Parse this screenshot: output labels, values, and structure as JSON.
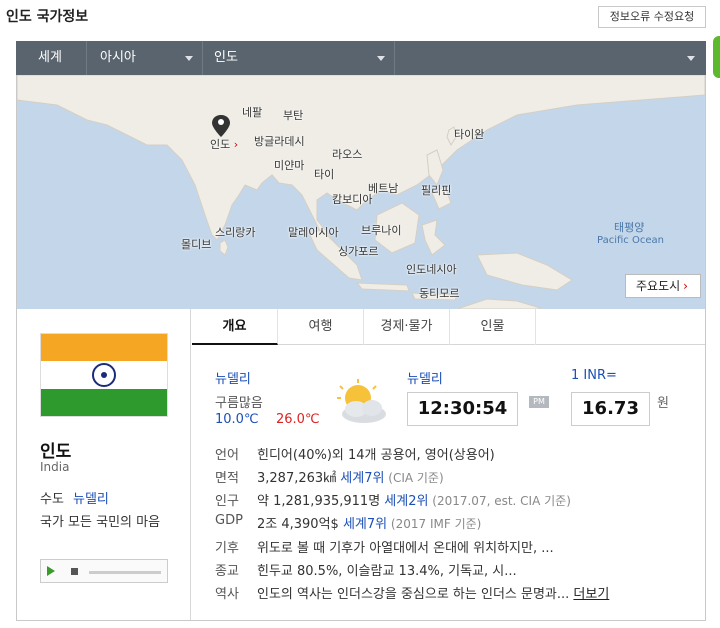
{
  "header": {
    "title": "인도 국가정보",
    "report_button": "정보오류 수정요청"
  },
  "nav": {
    "items": [
      {
        "label": "세계"
      },
      {
        "label": "아시아"
      },
      {
        "label": "인도"
      }
    ]
  },
  "map": {
    "labels": {
      "nepal": "네팔",
      "bhutan": "부탄",
      "india": "인도",
      "bangladesh": "방글라데시",
      "myanmar": "미얀마",
      "laos": "라오스",
      "taiwan": "타이완",
      "thailand": "타이",
      "vietnam": "베트남",
      "philippines": "필리핀",
      "cambodia": "캄보디아",
      "srilanka": "스리랑카",
      "maldives": "몰디브",
      "malaysia": "말레이시아",
      "brunei": "브루나이",
      "singapore": "싱가포르",
      "indonesia": "인도네시아",
      "easttimor": "동티모르",
      "pacific_ko": "태평양",
      "pacific_en": "Pacific Ocean"
    },
    "india_arrow": "›",
    "cities_button": "주요도시",
    "cities_arrow": "›"
  },
  "country": {
    "name_ko": "인도",
    "name_en": "India",
    "capital_label": "수도",
    "capital": "뉴델리",
    "anthem_text": "국가 모든 국민의 마음"
  },
  "flag": {
    "colors": [
      "#f5a623",
      "#ffffff",
      "#2e9a2e"
    ],
    "chakra_color": "#1b2b7a"
  },
  "tabs": [
    {
      "label": "개요",
      "active": true
    },
    {
      "label": "여행",
      "active": false
    },
    {
      "label": "경제·물가",
      "active": false
    },
    {
      "label": "인물",
      "active": false
    }
  ],
  "weather": {
    "city": "뉴델리",
    "condition": "구름많음",
    "low": "10.0℃",
    "high": "26.0℃",
    "icon": "partly-cloudy-icon"
  },
  "time": {
    "city": "뉴델리",
    "clock": "12:30:54",
    "ampm": "PM"
  },
  "currency": {
    "label": "1 INR=",
    "value": "16.73",
    "unit": "원"
  },
  "info": {
    "language": {
      "key": "언어",
      "value": "힌디어(40%)외 14개 공용어, 영어(상용어)"
    },
    "area": {
      "key": "면적",
      "value": "3,287,263㎢ ",
      "rank": "세계7위",
      "source": " (CIA 기준)"
    },
    "population": {
      "key": "인구",
      "value": "약 1,281,935,911명 ",
      "rank": "세계2위",
      "source": " (2017.07, est. CIA 기준)"
    },
    "gdp": {
      "key": "GDP",
      "value": "2조 4,390억$ ",
      "rank": "세계7위",
      "source": " (2017 IMF 기준)"
    },
    "climate": {
      "key": "기후",
      "value": "위도로 볼 때 기후가 아열대에서 온대에 위치하지만, ..."
    },
    "religion": {
      "key": "종교",
      "value": "힌두교 80.5%, 이슬람교 13.4%, 기독교, 시..."
    },
    "history": {
      "key": "역사",
      "value": "인도의 역사는 인더스강을 중심으로 하는 인더스 문명과... ",
      "more": "더보기"
    }
  }
}
